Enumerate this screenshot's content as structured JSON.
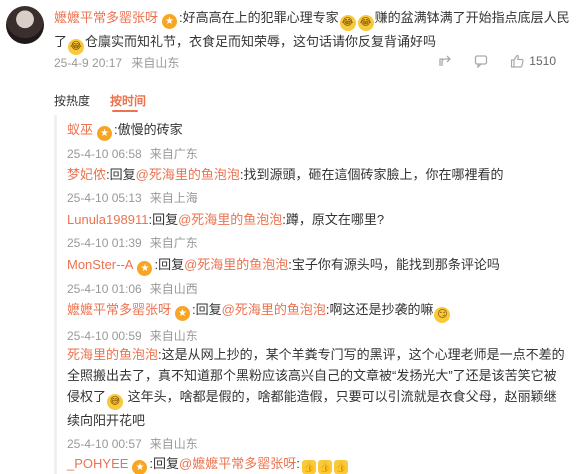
{
  "main_comment": {
    "username": "嬷嬷平常多罂张呀",
    "text_1": ":好高高在上的犯罪心理专家",
    "text_2": "赚的盆满钵满了开始指点底层人民了",
    "text_3": "仓廪实而知礼节，衣食足而知荣辱，这句话请你反复背诵好吗",
    "time": "25-4-9 20:17",
    "location": "来自山东",
    "like_count": "1510",
    "icons": [
      "share-icon",
      "comment-icon",
      "like-icon"
    ]
  },
  "tabs": [
    {
      "label": "按热度"
    },
    {
      "label": "按时间"
    }
  ],
  "replies": [
    {
      "user": "蚁巫",
      "prefix": "",
      "mention": "",
      "text": ":傲慢的砖家",
      "time": "25-4-10 06:58",
      "location": "来自广东"
    },
    {
      "user": "梦妃侬",
      "prefix": ":回复",
      "mention": "@死海里的鱼泡泡",
      "text": ":找到源頭，砸在這個砖家臉上，你在哪裡看的",
      "time": "25-4-10 05:13",
      "location": "来自上海"
    },
    {
      "user": "Lunula198911",
      "prefix": ":回复",
      "mention": "@死海里的鱼泡泡",
      "text": ":蹲，原文在哪里?",
      "time": "25-4-10 01:39",
      "location": "来自广东"
    },
    {
      "user": "MonSter--A",
      "prefix": ":回复",
      "mention": "@死海里的鱼泡泡",
      "text": ":宝子你有源头吗，能找到那条评论吗",
      "time": "25-4-10 01:06",
      "location": "来自山西"
    },
    {
      "user": "嬷嬷平常多罂张呀",
      "prefix": ":回复",
      "mention": "@死海里的鱼泡泡",
      "text": ":啊这还是抄袭的嘛",
      "time": "25-4-10 00:59",
      "location": "来自山东"
    },
    {
      "user": "死海里的鱼泡泡",
      "prefix": "",
      "mention": "",
      "text": ":这是从网上抄的，某个羊粪专门写的黑评，这个心理老师是一点不差的全照搬出去了，真不知道那个黑粉应该高兴自己的文章被“发扬光大”了还是该苦笑它被侵权了",
      "text_b": "这年头，啥都是假的，啥都能造假，只要可以引流就是衣食父母，赵丽颖继续向阳开花吧",
      "time": "25-4-10 00:57",
      "location": "来自山东"
    },
    {
      "user": "_POHYEE",
      "prefix": ":回复",
      "mention": "@嬷嬷平常多罂张呀",
      "text": ":",
      "time": "",
      "location": ""
    }
  ],
  "colors": {
    "accent": "#eb7350",
    "meta": "#999999",
    "text": "#333333"
  }
}
